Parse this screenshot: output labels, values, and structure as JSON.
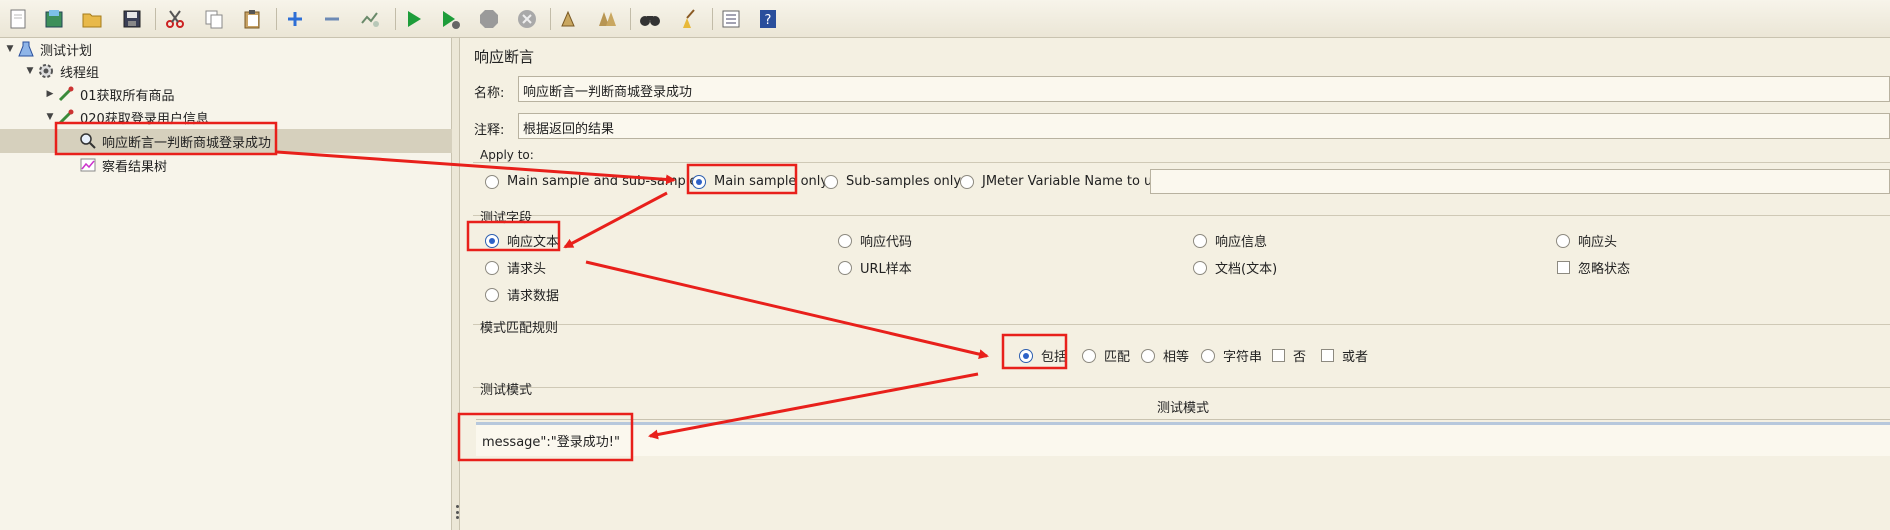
{
  "toolbar": {
    "icons": [
      "new-icon",
      "templates-icon",
      "open-icon",
      "save-icon",
      "cut-icon",
      "copy-icon",
      "paste-icon",
      "expand-icon",
      "collapse-icon",
      "toggle-icon",
      "start-icon",
      "start-no-pauses-icon",
      "stop-icon",
      "shutdown-icon",
      "clear-icon",
      "clear-all-icon",
      "search-icon",
      "reset-search-icon",
      "function-helper-icon",
      "help-icon"
    ]
  },
  "tree": {
    "items": [
      {
        "label": "测试计划"
      },
      {
        "label": "线程组"
      },
      {
        "label": "01获取所有商品"
      },
      {
        "label": "020获取登录用户信息"
      },
      {
        "label": "响应断言一判断商城登录成功"
      },
      {
        "label": "察看结果树"
      }
    ]
  },
  "panel": {
    "title": "响应断言",
    "name_label": "名称:",
    "name_value": "响应断言一判断商城登录成功",
    "comment_label": "注释:",
    "comment_value": "根据返回的结果",
    "apply_to": {
      "label": "Apply to:",
      "options": [
        "Main sample and sub-samples",
        "Main sample only",
        "Sub-samples only",
        "JMeter Variable Name to use"
      ],
      "selected": "Main sample only",
      "variable_value": ""
    },
    "test_field": {
      "label": "测试字段",
      "options": [
        "响应文本",
        "响应代码",
        "响应信息",
        "响应头",
        "请求头",
        "URL样本",
        "文档(文本)",
        "忽略状态",
        "请求数据"
      ],
      "selected": "响应文本"
    },
    "match_rules": {
      "label": "模式匹配规则",
      "options": [
        "包括",
        "匹配",
        "相等",
        "字符串"
      ],
      "checkboxes": [
        "否",
        "或者"
      ],
      "selected": "包括"
    },
    "patterns": {
      "label": "测试模式",
      "column_header": "测试模式",
      "rows": [
        "message\":\"登录成功!\""
      ]
    }
  },
  "colors": {
    "annotation": "#e8201b",
    "selection_blue": "#2d62c8",
    "background": "#f4f0e2"
  }
}
